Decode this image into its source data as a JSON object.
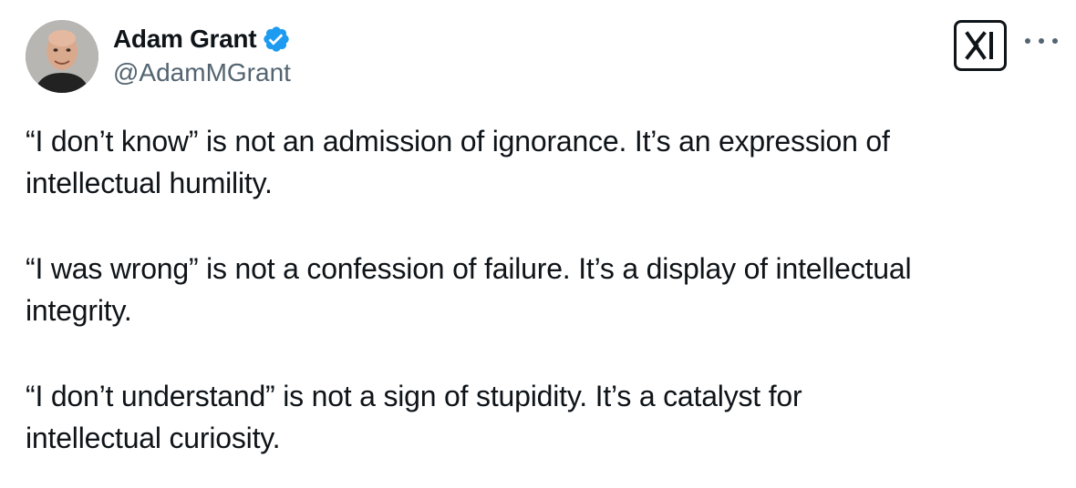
{
  "author": {
    "display_name": "Adam Grant",
    "handle": "@AdamMGrant",
    "verified": true,
    "avatar": "profile-photo"
  },
  "icons": {
    "verified": "verified-badge-icon",
    "brand": "x-logo-icon",
    "more": "more-options-icon"
  },
  "colors": {
    "verified_blue": "#1d9bf0",
    "text_primary": "#0f1419",
    "text_secondary": "#536471"
  },
  "tweet": {
    "paragraphs": [
      {
        "line1": "“I don’t know” is not an admission of ignorance. It’s an expression of",
        "line2": "intellectual humility."
      },
      {
        "line1": "“I was wrong” is not a confession of failure. It’s a display of intellectual",
        "line2": "integrity."
      },
      {
        "line1": "“I don’t understand” is not a sign of stupidity. It’s a catalyst for",
        "line2": "intellectual curiosity."
      }
    ]
  }
}
